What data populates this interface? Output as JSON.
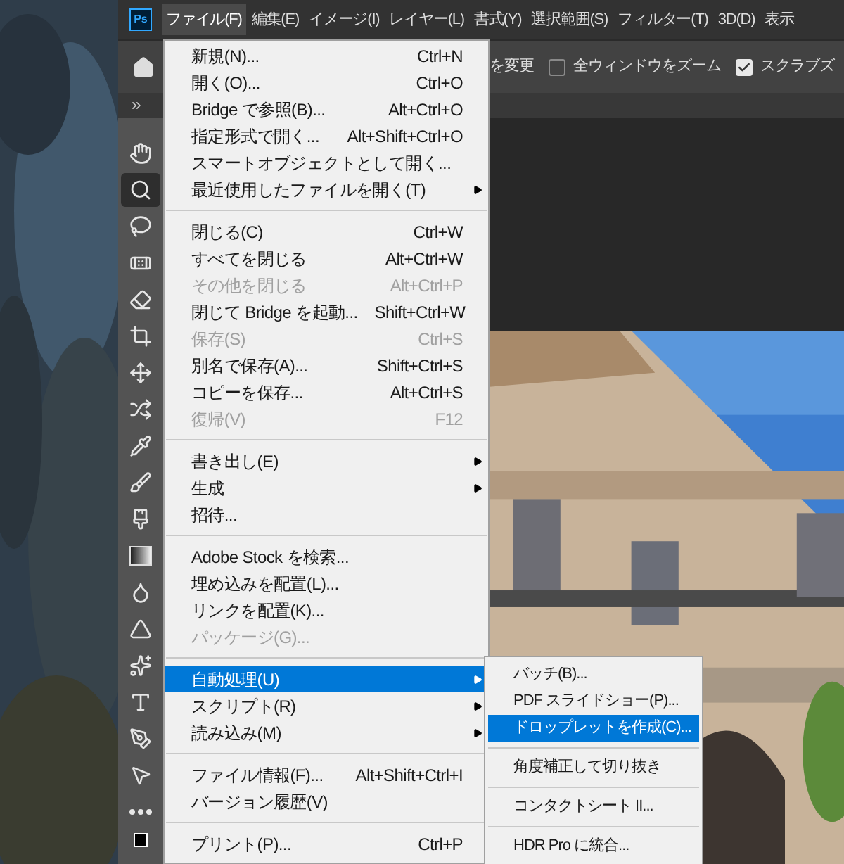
{
  "app_logo": "Ps",
  "menu_bar": [
    {
      "label": "ファイル(F)",
      "selected": true
    },
    {
      "label": "編集(E)",
      "selected": false
    },
    {
      "label": "イメージ(I)",
      "selected": false
    },
    {
      "label": "レイヤー(L)",
      "selected": false
    },
    {
      "label": "書式(Y)",
      "selected": false
    },
    {
      "label": "選択範囲(S)",
      "selected": false
    },
    {
      "label": "フィルター(T)",
      "selected": false
    },
    {
      "label": "3D(D)",
      "selected": false
    },
    {
      "label": "表示",
      "selected": false
    }
  ],
  "options_bar": {
    "partial_label": "を変更",
    "checkboxes": [
      {
        "label": "全ウィンドウをズーム",
        "checked": false
      },
      {
        "label": "スクラブズ",
        "checked": true
      }
    ]
  },
  "tools": [
    {
      "selected": false
    },
    {
      "selected": true
    },
    {
      "selected": false
    },
    {
      "selected": false
    },
    {
      "selected": false
    },
    {
      "selected": false
    },
    {
      "selected": false
    },
    {
      "selected": false
    },
    {
      "selected": false
    },
    {
      "selected": false
    },
    {
      "selected": false
    },
    {
      "selected": false
    },
    {
      "selected": false
    },
    {
      "selected": false
    },
    {
      "selected": false
    },
    {
      "selected": false
    },
    {
      "selected": false
    },
    {
      "selected": false
    },
    {
      "selected": false
    }
  ],
  "file_menu": [
    {
      "kind": "item",
      "label": "新規(N)...",
      "shortcut": "Ctrl+N",
      "disabled": false,
      "selected": false,
      "submenu": false
    },
    {
      "kind": "item",
      "label": "開く(O)...",
      "shortcut": "Ctrl+O",
      "disabled": false,
      "selected": false,
      "submenu": false
    },
    {
      "kind": "item",
      "label": "Bridge で参照(B)...",
      "shortcut": "Alt+Ctrl+O",
      "disabled": false,
      "selected": false,
      "submenu": false
    },
    {
      "kind": "item",
      "label": "指定形式で開く...",
      "shortcut": "Alt+Shift+Ctrl+O",
      "disabled": false,
      "selected": false,
      "submenu": false
    },
    {
      "kind": "item",
      "label": "スマートオブジェクトとして開く...",
      "disabled": false,
      "selected": false,
      "submenu": false
    },
    {
      "kind": "item",
      "label": "最近使用したファイルを開く(T)",
      "disabled": false,
      "selected": false,
      "submenu": true
    },
    {
      "kind": "separator"
    },
    {
      "kind": "item",
      "label": "閉じる(C)",
      "shortcut": "Ctrl+W",
      "disabled": false,
      "selected": false,
      "submenu": false
    },
    {
      "kind": "item",
      "label": "すべてを閉じる",
      "shortcut": "Alt+Ctrl+W",
      "disabled": false,
      "selected": false,
      "submenu": false
    },
    {
      "kind": "item",
      "label": "その他を閉じる",
      "shortcut": "Alt+Ctrl+P",
      "disabled": true,
      "selected": false,
      "submenu": false
    },
    {
      "kind": "item",
      "label": "閉じて Bridge を起動...",
      "shortcut": "Shift+Ctrl+W",
      "disabled": false,
      "selected": false,
      "submenu": false
    },
    {
      "kind": "item",
      "label": "保存(S)",
      "shortcut": "Ctrl+S",
      "disabled": true,
      "selected": false,
      "submenu": false
    },
    {
      "kind": "item",
      "label": "別名で保存(A)...",
      "shortcut": "Shift+Ctrl+S",
      "disabled": false,
      "selected": false,
      "submenu": false
    },
    {
      "kind": "item",
      "label": "コピーを保存...",
      "shortcut": "Alt+Ctrl+S",
      "disabled": false,
      "selected": false,
      "submenu": false
    },
    {
      "kind": "item",
      "label": "復帰(V)",
      "shortcut": "F12",
      "disabled": true,
      "selected": false,
      "submenu": false
    },
    {
      "kind": "separator"
    },
    {
      "kind": "item",
      "label": "書き出し(E)",
      "disabled": false,
      "selected": false,
      "submenu": true
    },
    {
      "kind": "item",
      "label": "生成",
      "disabled": false,
      "selected": false,
      "submenu": true
    },
    {
      "kind": "item",
      "label": "招待...",
      "disabled": false,
      "selected": false,
      "submenu": false
    },
    {
      "kind": "separator"
    },
    {
      "kind": "item",
      "label": "Adobe Stock を検索...",
      "disabled": false,
      "selected": false,
      "submenu": false
    },
    {
      "kind": "item",
      "label": "埋め込みを配置(L)...",
      "disabled": false,
      "selected": false,
      "submenu": false
    },
    {
      "kind": "item",
      "label": "リンクを配置(K)...",
      "disabled": false,
      "selected": false,
      "submenu": false
    },
    {
      "kind": "item",
      "label": "パッケージ(G)...",
      "disabled": true,
      "selected": false,
      "submenu": false
    },
    {
      "kind": "separator"
    },
    {
      "kind": "item",
      "label": "自動処理(U)",
      "disabled": false,
      "selected": true,
      "submenu": true
    },
    {
      "kind": "item",
      "label": "スクリプト(R)",
      "disabled": false,
      "selected": false,
      "submenu": true
    },
    {
      "kind": "item",
      "label": "読み込み(M)",
      "disabled": false,
      "selected": false,
      "submenu": true
    },
    {
      "kind": "separator"
    },
    {
      "kind": "item",
      "label": "ファイル情報(F)...",
      "shortcut": "Alt+Shift+Ctrl+I",
      "disabled": false,
      "selected": false,
      "submenu": false
    },
    {
      "kind": "item",
      "label": "バージョン履歴(V)",
      "disabled": false,
      "selected": false,
      "submenu": false
    },
    {
      "kind": "separator"
    },
    {
      "kind": "item",
      "label": "プリント(P)...",
      "shortcut": "Ctrl+P",
      "disabled": false,
      "selected": false,
      "submenu": false
    }
  ],
  "automate_submenu": [
    {
      "kind": "item",
      "label": "バッチ(B)...",
      "selected": false
    },
    {
      "kind": "item",
      "label": "PDF スライドショー(P)...",
      "selected": false
    },
    {
      "kind": "item",
      "label": "ドロップレットを作成(C)...",
      "selected": true
    },
    {
      "kind": "separator"
    },
    {
      "kind": "item",
      "label": "角度補正して切り抜き",
      "selected": false
    },
    {
      "kind": "separator"
    },
    {
      "kind": "item",
      "label": "コンタクトシート II...",
      "selected": false
    },
    {
      "kind": "separator"
    },
    {
      "kind": "item",
      "label": "HDR Pro に統合...",
      "selected": false
    }
  ]
}
